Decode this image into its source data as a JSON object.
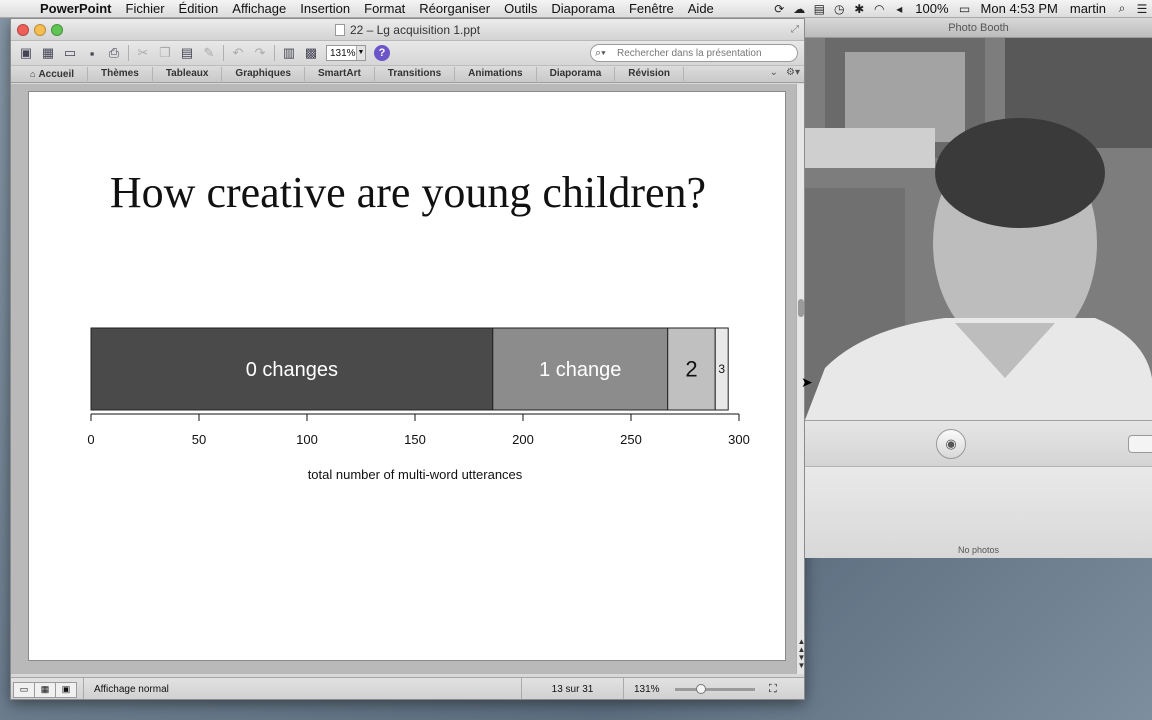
{
  "menubar": {
    "app_name": "PowerPoint",
    "items": [
      "Fichier",
      "Édition",
      "Affichage",
      "Insertion",
      "Format",
      "Réorganiser",
      "Outils",
      "Diaporama",
      "Fenêtre",
      "Aide"
    ],
    "battery": "100%",
    "clock": "Mon 4:53 PM",
    "user": "martin"
  },
  "ppt_window": {
    "title": "22 – Lg acquisition 1.ppt",
    "zoom_value": "131%",
    "search_placeholder": "Rechercher dans la présentation",
    "ribbon_tabs": [
      "Accueil",
      "Thèmes",
      "Tableaux",
      "Graphiques",
      "SmartArt",
      "Transitions",
      "Animations",
      "Diaporama",
      "Révision"
    ]
  },
  "slide": {
    "title": "How creative are young children?"
  },
  "chart_data": {
    "type": "bar",
    "orientation": "horizontal-stacked",
    "title": "",
    "xlabel": "total number of multi-word utterances",
    "xlim": [
      0,
      300
    ],
    "ticks": [
      0,
      50,
      100,
      150,
      200,
      250,
      300
    ],
    "segments": [
      {
        "label": "0 changes",
        "value": 186,
        "color": "#4a4a4a",
        "text_color": "#ffffff"
      },
      {
        "label": "1 change",
        "value": 81,
        "color": "#8c8c8c",
        "text_color": "#ffffff"
      },
      {
        "label": "2",
        "value": 22,
        "color": "#c0c0c0",
        "text_color": "#111111"
      },
      {
        "label": "3",
        "value": 6,
        "color": "#e8e8e8",
        "text_color": "#111111"
      }
    ]
  },
  "statusbar": {
    "view_label": "Affichage normal",
    "slide_position": "13 sur 31",
    "zoom": "131%"
  },
  "photo_booth": {
    "title": "Photo Booth",
    "tray_label": "No photos"
  }
}
